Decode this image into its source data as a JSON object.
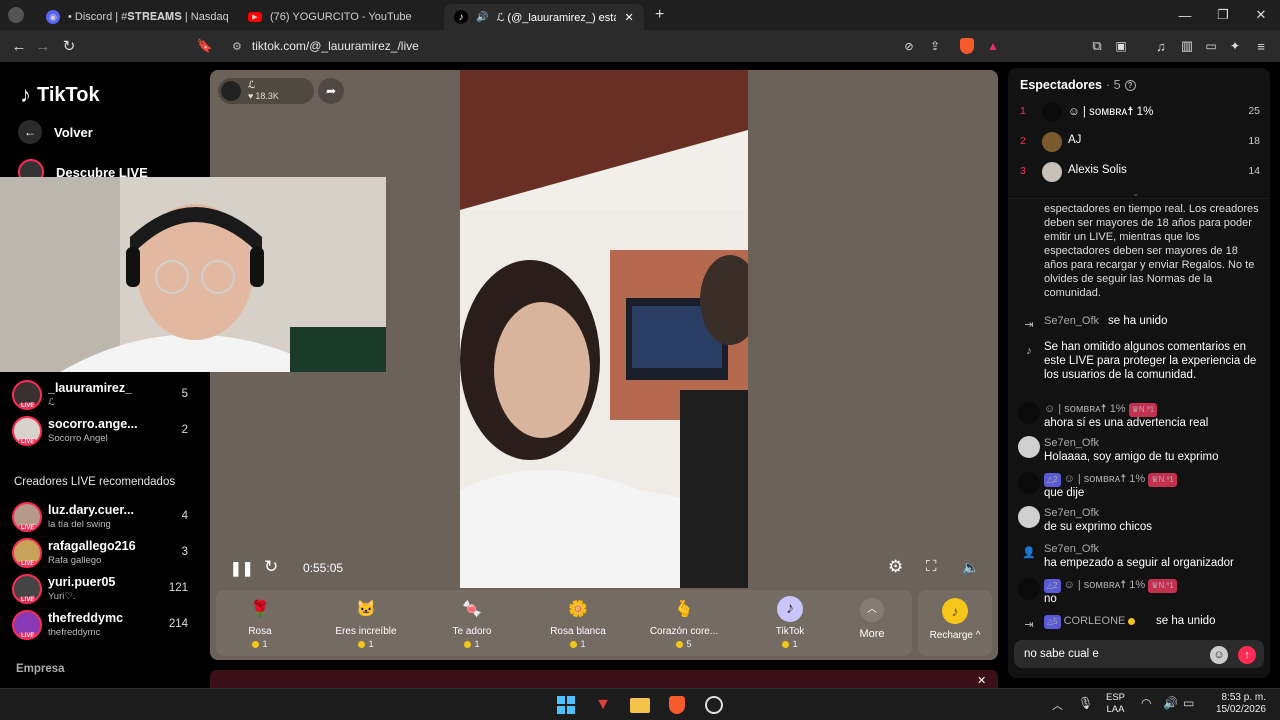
{
  "browser": {
    "tabs": [
      {
        "label": "• Discord | #𝐒𝐓𝐑𝐄𝐀𝐌𝐒 | Nasdaq",
        "icon": "discord-icon"
      },
      {
        "label": "(76) YOGURCITO - YouTube",
        "icon": "youtube-icon"
      },
      {
        "label": "ℒ (@_lauuramirez_) está emiti",
        "icon": "tiktok-icon"
      }
    ],
    "url": "tiktok.com/@_lauuramirez_/live",
    "new_tab": "+",
    "min": "—",
    "max": "❐",
    "close": "✕"
  },
  "nav": {
    "logo": "TikTok",
    "back": "Volver",
    "discover": "Descubre LIVE",
    "following": [
      {
        "name": "_lauuramirez_",
        "sub": "ℒ",
        "count": "5"
      },
      {
        "name": "socorro.ange...",
        "sub": "Socorro Angel",
        "count": "2"
      }
    ],
    "recommended_title": "Creadores LIVE recomendados",
    "recommended": [
      {
        "name": "luz.dary.cuer...",
        "sub": "la tía del swing",
        "count": "4"
      },
      {
        "name": "rafagallego216",
        "sub": "Rafa gallego",
        "count": "3"
      },
      {
        "name": "yuri.puer05",
        "sub": "Yuri♡.",
        "count": "121"
      },
      {
        "name": "thefreddymc",
        "sub": "thefreddymc",
        "count": "214"
      }
    ],
    "company": "Empresa",
    "live_tag": "LIVE"
  },
  "player": {
    "host_name": "ℒ",
    "host_likes": "18.3K",
    "time": "0:55:05",
    "gifts": [
      {
        "name": "Rosa",
        "price": "1",
        "emoji": "🌹"
      },
      {
        "name": "Eres increíble",
        "price": "1",
        "emoji": "🐱"
      },
      {
        "name": "Te adoro",
        "price": "1",
        "emoji": "🍬"
      },
      {
        "name": "Rosa blanca",
        "price": "1",
        "emoji": "🌼"
      },
      {
        "name": "Corazón core...",
        "price": "5",
        "emoji": "🫰"
      },
      {
        "name": "TikTok",
        "price": "1",
        "emoji": "♪"
      }
    ],
    "more": "More",
    "recharge": "Recharge ^"
  },
  "chat": {
    "title": "Espectadores",
    "viewer_count": "· 5",
    "viewers": [
      {
        "rank": "1",
        "name": "☺ | sᴏᴍʙʀᴀ☨ 1%",
        "score": "25",
        "color": "#111111"
      },
      {
        "rank": "2",
        "name": "AJ",
        "score": "18",
        "color": "#7a5a2e"
      },
      {
        "rank": "3",
        "name": "Alexis Solis",
        "score": "14",
        "color": "#c7c0b8"
      }
    ],
    "notice": "espectadores en tiempo real. Los creadores deben ser mayores de 18 años para poder emitir un LIVE, mientras que los espectadores deben ser mayores de 18 años para recargar y enviar Regalos. No te olvides de seguir las Normas de la comunidad.",
    "messages": [
      {
        "user": "Se7en_Ofk",
        "text": "se ha unido",
        "type": "join"
      },
      {
        "user": "",
        "text": "Se han omitido algunos comentarios en este LIVE para proteger la experiencia de los usuarios de la comunidad.",
        "type": "system"
      },
      {
        "user": "☺ | sᴏᴍʙʀᴀ☨ 1%",
        "badge": "♛N.º1",
        "text": "ahora sí es una advertencia real",
        "type": "comment"
      },
      {
        "user": "Se7en_Ofk",
        "text": "Holaaaa, soy amigo de tu exprimo",
        "type": "comment"
      },
      {
        "user": "☺ | sᴏᴍʙʀᴀ☨ 1%",
        "level": "△2",
        "badge": "♛N.º1",
        "text": "que dije",
        "type": "comment"
      },
      {
        "user": "Se7en_Ofk",
        "text": "de su exprimo chicos",
        "type": "comment"
      },
      {
        "user": "Se7en_Ofk",
        "text": "ha empezado a seguir al organizador",
        "type": "follow"
      },
      {
        "user": "☺ | sᴏᴍʙʀᴀ☨ 1%",
        "level": "△2",
        "badge": "♛N.º1",
        "text": "no",
        "type": "comment"
      },
      {
        "user": "CORLEONE",
        "level": "△5",
        "text": "se ha unido",
        "type": "join2"
      }
    ],
    "input": "no sabe cual e"
  },
  "taskbar": {
    "lang1": "ESP",
    "lang2": "LAA",
    "time": "8:53 p. m.",
    "date": "15/02/2026"
  }
}
